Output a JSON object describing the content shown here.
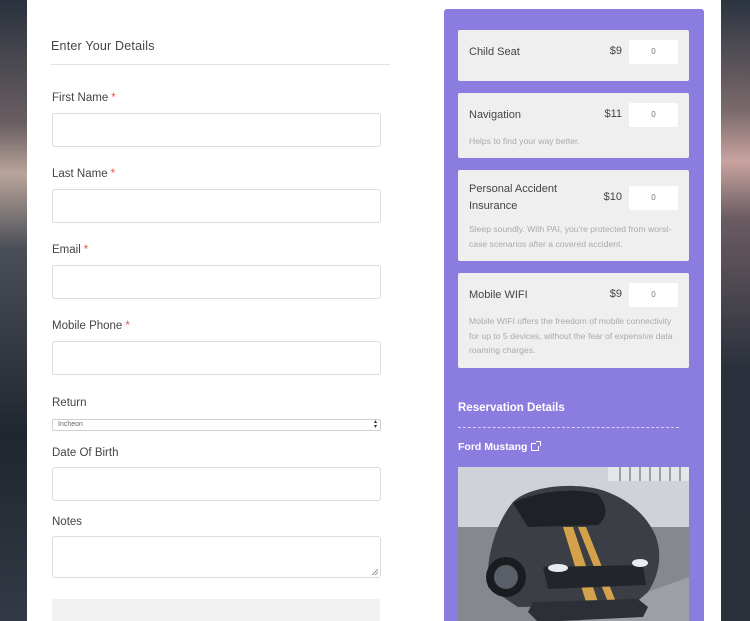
{
  "form": {
    "title": "Enter Your Details",
    "required_mark": "*",
    "fields": {
      "first_name": {
        "label": "First Name",
        "value": ""
      },
      "last_name": {
        "label": "Last Name",
        "value": ""
      },
      "email": {
        "label": "Email",
        "value": ""
      },
      "mobile_phone": {
        "label": "Mobile Phone",
        "value": ""
      },
      "return": {
        "label": "Return",
        "value": "Incheon"
      },
      "date_of_birth": {
        "label": "Date Of Birth",
        "value": ""
      },
      "notes": {
        "label": "Notes",
        "value": ""
      }
    }
  },
  "extras": [
    {
      "name": "Child Seat",
      "price": "$9",
      "qty": "0",
      "desc": ""
    },
    {
      "name": "Navigation",
      "price": "$11",
      "qty": "0",
      "desc": "Helps to find your way better."
    },
    {
      "name": "Personal Accident Insurance",
      "price": "$10",
      "qty": "0",
      "desc": "Sleep soundly. With PAI, you're protected from worst-case scenarios after a covered accident."
    },
    {
      "name": "Mobile WIFI",
      "price": "$9",
      "qty": "0",
      "desc": "Mobile WIFI offers the freedom of mobile connectivity for up to 5 devices, without the fear of expensive data roaming charges."
    }
  ],
  "reservation": {
    "title": "Reservation Details",
    "car_name": "Ford Mustang",
    "icons": {
      "external_link": "external-link-icon"
    }
  },
  "colors": {
    "sidebar": "#8b7ce0",
    "required": "#e8554e",
    "card": "#efefef"
  }
}
